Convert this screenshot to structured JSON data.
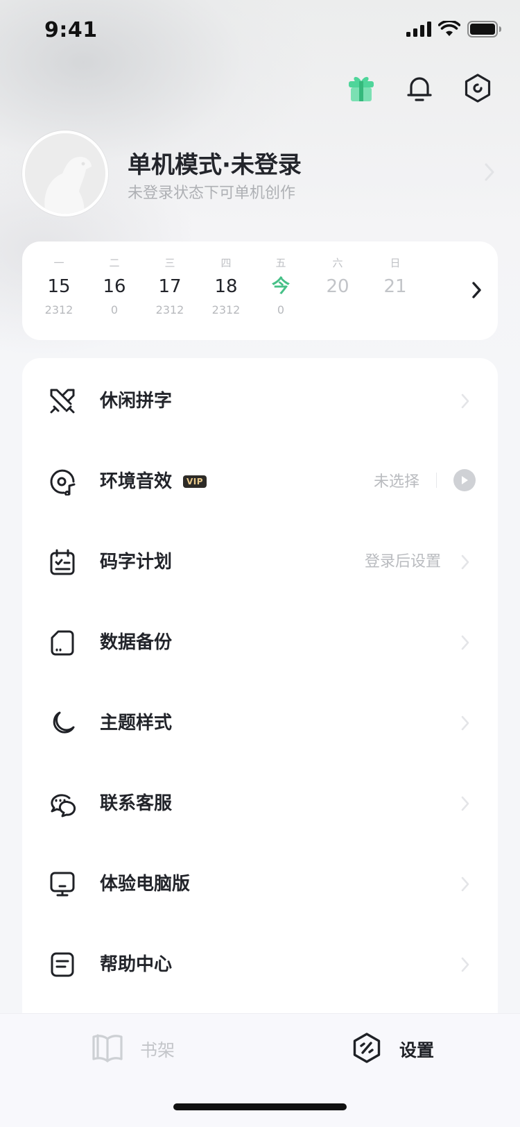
{
  "status_bar": {
    "time": "9:41"
  },
  "top_actions": {
    "gift_icon": "gift-icon",
    "bell_icon": "bell-icon",
    "settings_icon": "hexagon-settings-icon"
  },
  "profile": {
    "name": "单机模式·未登录",
    "subtitle": "未登录状态下可单机创作"
  },
  "week": {
    "days": [
      {
        "weekday": "一",
        "date": "15",
        "count": "2312"
      },
      {
        "weekday": "二",
        "date": "16",
        "count": "0"
      },
      {
        "weekday": "三",
        "date": "17",
        "count": "2312"
      },
      {
        "weekday": "四",
        "date": "18",
        "count": "2312"
      },
      {
        "weekday": "五",
        "date": "今",
        "count": "0"
      },
      {
        "weekday": "六",
        "date": "20",
        "count": ""
      },
      {
        "weekday": "日",
        "date": "21",
        "count": ""
      }
    ],
    "today_color": "#46c087"
  },
  "menu": {
    "items": [
      {
        "label": "休闲拼字",
        "icon": "crossed-swords-icon"
      },
      {
        "label": "环境音效",
        "badge": "VIP",
        "value": "未选择",
        "icon": "music-disc-icon"
      },
      {
        "label": "码字计划",
        "value": "登录后设置",
        "icon": "calendar-check-icon"
      },
      {
        "label": "数据备份",
        "icon": "sd-card-icon"
      },
      {
        "label": "主题样式",
        "icon": "moon-icon"
      },
      {
        "label": "联系客服",
        "icon": "chat-bubbles-icon"
      },
      {
        "label": "体验电脑版",
        "icon": "monitor-icon"
      },
      {
        "label": "帮助中心",
        "icon": "document-icon"
      }
    ]
  },
  "tab_bar": {
    "tabs": [
      {
        "label": "书架",
        "icon": "book-icon",
        "active": false
      },
      {
        "label": "设置",
        "icon": "settings-tab-icon",
        "active": true
      }
    ]
  }
}
